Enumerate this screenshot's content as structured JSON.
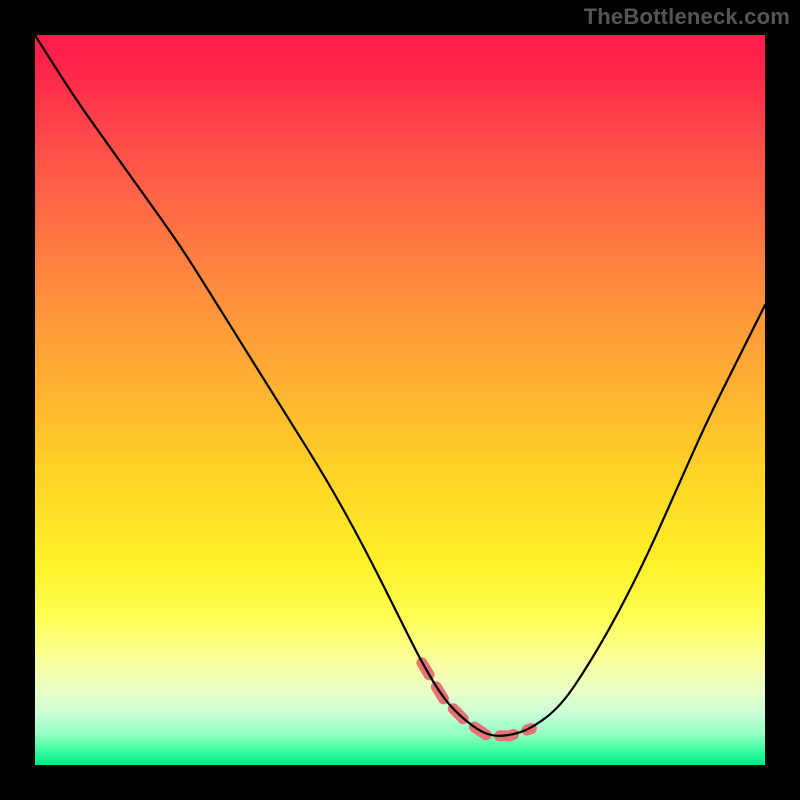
{
  "watermark": "TheBottleneck.com",
  "chart_data": {
    "type": "line",
    "title": "",
    "xlabel": "",
    "ylabel": "",
    "xlim": [
      0,
      100
    ],
    "ylim": [
      0,
      100
    ],
    "series": [
      {
        "name": "bottleneck-curve",
        "x": [
          0,
          5,
          10,
          15,
          20,
          25,
          30,
          35,
          40,
          45,
          50,
          53,
          56,
          59,
          62,
          65,
          68,
          72,
          76,
          80,
          84,
          88,
          92,
          96,
          100
        ],
        "values": [
          100,
          92,
          85,
          78,
          71,
          63,
          55,
          47,
          39,
          30,
          20,
          14,
          9,
          6,
          4,
          4,
          5,
          8,
          14,
          21,
          29,
          38,
          47,
          55,
          63
        ]
      }
    ],
    "highlight_region": {
      "name": "optimal-range",
      "x_start": 52,
      "x_end": 70,
      "description": "pink dashed segment near curve minimum"
    },
    "background_gradient": {
      "top": "#ff1a4d",
      "bottom": "#00e888",
      "stops": [
        "red",
        "orange",
        "yellow",
        "green"
      ]
    }
  }
}
